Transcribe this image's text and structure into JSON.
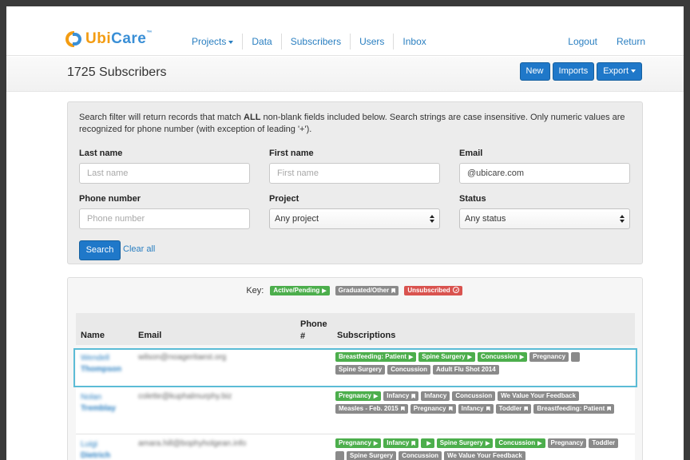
{
  "brand": {
    "ubi": "Ubi",
    "care": "Care",
    "tm": "™"
  },
  "nav": {
    "items": [
      {
        "label": "Projects",
        "dropdown": true
      },
      {
        "label": "Data"
      },
      {
        "label": "Subscribers"
      },
      {
        "label": "Users"
      },
      {
        "label": "Inbox"
      }
    ],
    "right": [
      {
        "label": "Logout"
      },
      {
        "label": "Return"
      }
    ]
  },
  "header": {
    "title": "1725 Subscribers",
    "buttons": {
      "new": "New",
      "imports": "Imports",
      "export": "Export"
    }
  },
  "filter": {
    "note_pre": "Search filter will return records that match ",
    "note_bold": "ALL",
    "note_post": " non-blank fields included below. Search strings are case insensitive. Only numeric values are recognized for phone number (with exception of leading '+').",
    "last_name": {
      "label": "Last name",
      "placeholder": "Last name",
      "value": ""
    },
    "first_name": {
      "label": "First name",
      "placeholder": "First name",
      "value": ""
    },
    "email": {
      "label": "Email",
      "placeholder": "",
      "value": "@ubicare.com"
    },
    "phone": {
      "label": "Phone number",
      "placeholder": "Phone number",
      "value": ""
    },
    "project": {
      "label": "Project",
      "selected": "Any project"
    },
    "status": {
      "label": "Status",
      "selected": "Any status"
    },
    "search_label": "Search",
    "clear_label": "Clear all"
  },
  "key": {
    "label": "Key:",
    "active": "Active/Pending",
    "graduated": "Graduated/Other",
    "unsubscribed": "Unsubscribed"
  },
  "table": {
    "headers": {
      "name": "Name",
      "email": "Email",
      "phone": "Phone #",
      "subscriptions": "Subscriptions"
    },
    "rows": [
      {
        "first": "Wendell",
        "last": "Thompson",
        "email": "wilson@noageritaest.org",
        "tags": [
          {
            "label": "Breastfeeding: Patient",
            "color": "green",
            "glyph": "play"
          },
          {
            "label": "Spine Surgery",
            "color": "green",
            "glyph": "play"
          },
          {
            "label": "Concussion",
            "color": "green",
            "glyph": "play"
          },
          {
            "label": "Pregnancy",
            "color": "gray",
            "glyph": ""
          },
          {
            "label": "",
            "color": "gray",
            "glyph": ""
          },
          {
            "label": "Spine Surgery",
            "color": "gray",
            "glyph": ""
          },
          {
            "label": "Concussion",
            "color": "gray",
            "glyph": ""
          },
          {
            "label": "Adult Flu Shot 2014",
            "color": "gray",
            "glyph": ""
          }
        ]
      },
      {
        "first": "Nolan",
        "last": "Tremblay",
        "email": "colette@kuphalmurphy.biz",
        "tags": [
          {
            "label": "Pregnancy",
            "color": "green",
            "glyph": "play"
          },
          {
            "label": "Infancy",
            "color": "gray",
            "glyph": "bookmark"
          },
          {
            "label": "Infancy",
            "color": "gray",
            "glyph": ""
          },
          {
            "label": "Concussion",
            "color": "gray",
            "glyph": ""
          },
          {
            "label": "We Value Your Feedback",
            "color": "gray",
            "glyph": ""
          },
          {
            "label": "Measles - Feb. 2015",
            "color": "gray",
            "glyph": "bookmark"
          },
          {
            "label": "Pregnancy",
            "color": "gray",
            "glyph": "bookmark"
          },
          {
            "label": "Infancy",
            "color": "gray",
            "glyph": "bookmark"
          },
          {
            "label": "Toddler",
            "color": "gray",
            "glyph": "bookmark"
          },
          {
            "label": "Breastfeeding: Patient",
            "color": "gray",
            "glyph": "bookmark"
          }
        ]
      },
      {
        "first": "Luigi",
        "last": "Dietrich",
        "email": "amara.hill@bophyholgean.info",
        "tags": [
          {
            "label": "Pregnancy",
            "color": "green",
            "glyph": "play"
          },
          {
            "label": "Infancy",
            "color": "green",
            "glyph": "bookmark"
          },
          {
            "label": "",
            "color": "green",
            "glyph": "play"
          },
          {
            "label": "Spine Surgery",
            "color": "green",
            "glyph": "play"
          },
          {
            "label": "Concussion",
            "color": "green",
            "glyph": "play"
          },
          {
            "label": "Pregnancy",
            "color": "gray",
            "glyph": ""
          },
          {
            "label": "Toddler",
            "color": "gray",
            "glyph": ""
          },
          {
            "label": "",
            "color": "gray",
            "glyph": ""
          },
          {
            "label": "Spine Surgery",
            "color": "gray",
            "glyph": ""
          },
          {
            "label": "Concussion",
            "color": "gray",
            "glyph": ""
          },
          {
            "label": "We Value Your Feedback",
            "color": "gray",
            "glyph": ""
          }
        ]
      }
    ]
  }
}
